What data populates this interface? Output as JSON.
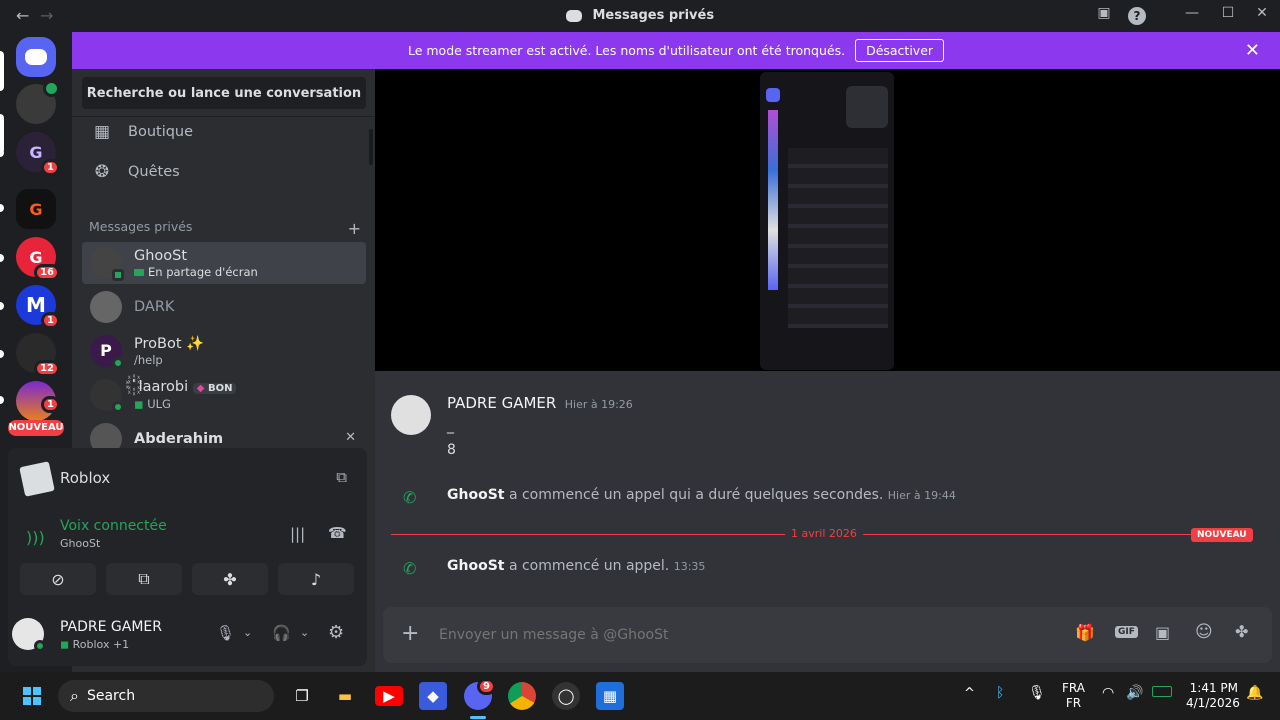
{
  "window": {
    "title": "Messages privés"
  },
  "banner": {
    "text": "Le mode streamer est activé. Les noms d'utilisateur ont été tronqués.",
    "button": "Désactiver"
  },
  "servers": [
    {
      "badge": ""
    },
    {
      "badge": "1"
    },
    {
      "badge": ""
    },
    {
      "badge": "16"
    },
    {
      "badge": "1"
    },
    {
      "badge": "12"
    },
    {
      "badge": "1",
      "tag": "NOUVEAU"
    }
  ],
  "sidebar": {
    "search": "Recherche ou lance une conversation",
    "nav": [
      {
        "label": "Boutique",
        "icon": "shop-icon"
      },
      {
        "label": "Quêtes",
        "icon": "quests-icon"
      }
    ],
    "dm_header": "Messages privés",
    "dms": [
      {
        "name": "GhooSt",
        "sub": "En partage d'écran"
      },
      {
        "name": "DARK",
        "sub": ""
      },
      {
        "name": "ProBot ✨",
        "sub": "/help"
      },
      {
        "name": "꙰ꙴ꙰ laarobi",
        "tag": "BON",
        "sub": "ULG"
      },
      {
        "name": "Abderahim",
        "sub": ""
      }
    ]
  },
  "voice": {
    "activity": "Roblox",
    "status": "Voix connectée",
    "channel": "GhooSt"
  },
  "user": {
    "name": "PADRE GAMER",
    "activity": "Roblox",
    "extra": "+1"
  },
  "chat": {
    "messages": [
      {
        "author": "PADRE GAMER",
        "time": "Hier à 19:26",
        "lines": [
          "_",
          "8"
        ]
      }
    ],
    "call1": {
      "user": "GhooSt",
      "text": "a commencé un appel qui a duré quelques secondes.",
      "time": "Hier à 19:44"
    },
    "divider": {
      "date": "1 avril 2026",
      "tag": "NOUVEAU"
    },
    "call2": {
      "user": "GhooSt",
      "text": "a commencé un appel.",
      "time": "13:35"
    },
    "input_placeholder": "Envoyer un message à @GhooSt",
    "gif_label": "GIF"
  },
  "taskbar": {
    "search": "Search",
    "lang1": "FRA",
    "lang2": "FR",
    "time": "1:41 PM",
    "date": "4/1/2026",
    "discord_badge": "9"
  },
  "colors": {
    "accent": "#5865f2",
    "banner": "#8c38ef",
    "online": "#23a55a",
    "danger": "#f23f43"
  }
}
